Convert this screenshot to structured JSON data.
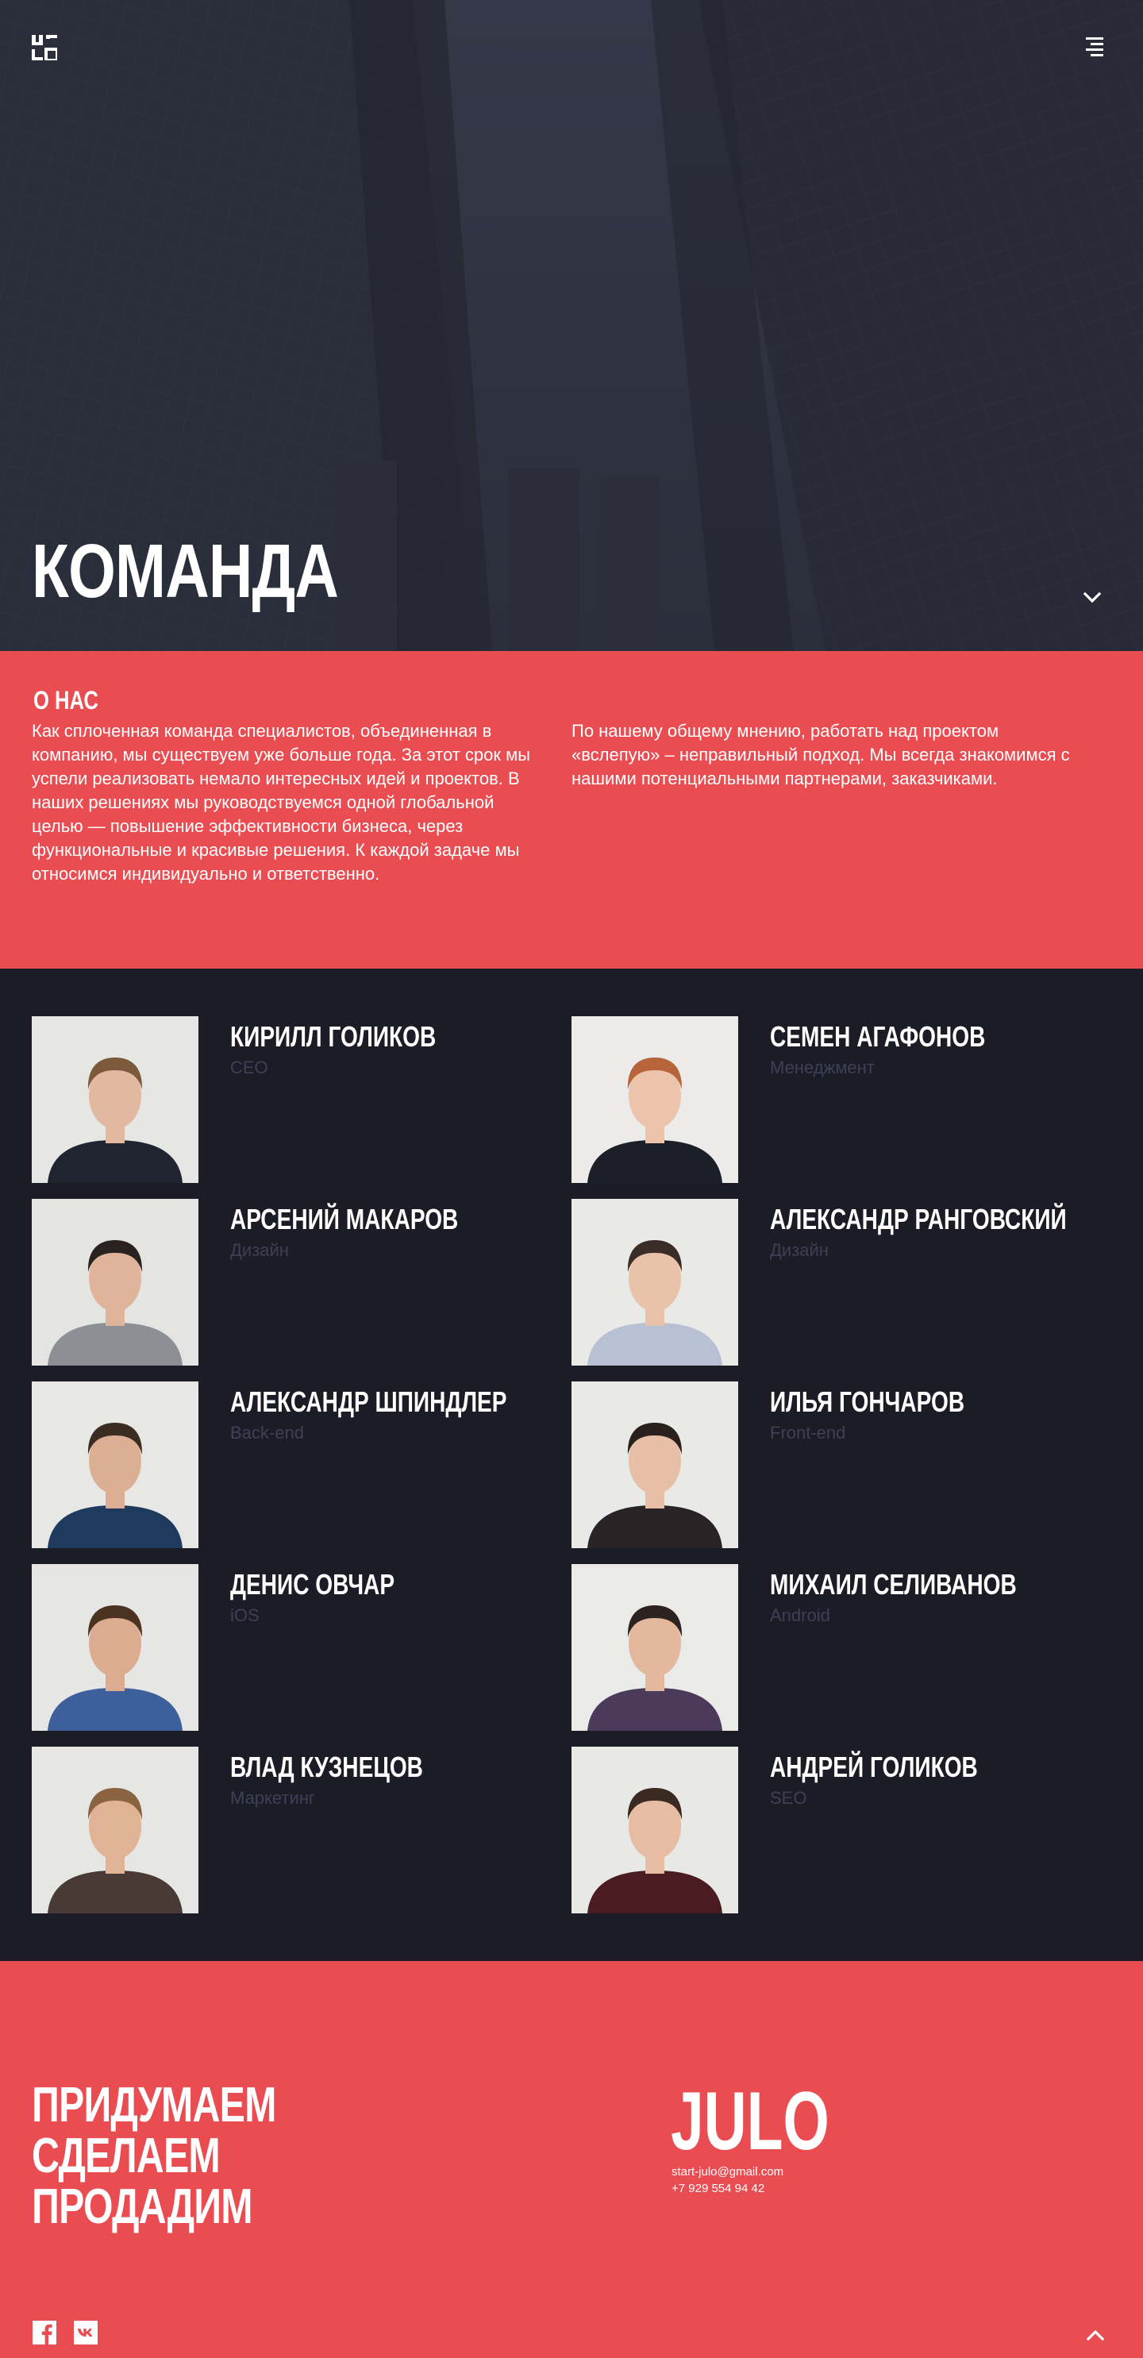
{
  "header": {
    "logo_icon": "julo-logo-icon",
    "menu_icon": "menu-icon"
  },
  "hero": {
    "title": "КОМАНДА",
    "scroll_icon": "chevron-down-icon"
  },
  "about": {
    "heading": "О НАС",
    "paragraph_1": "Как сплоченная команда специалистов, объединенная в компанию, мы существуем уже больше года. За этот срок мы успели реализовать немало интересных идей и проектов.  В наших решениях мы руководствуемся одной глобальной целью — повышение эффективности бизнеса, через функциональные и красивые решения. К каждой задаче мы относимся индивидуально и ответственно.",
    "paragraph_2": "По нашему общему  мнению, работать над проектом «вслепую» – неправильный подход. Мы всегда знакомимся с нашими потенциальными партнерами, заказчиками."
  },
  "team": {
    "members": [
      {
        "name": "КИРИЛЛ ГОЛИКОВ",
        "role": "CEO"
      },
      {
        "name": "СЕМЕН АГАФОНОВ",
        "role": "Менеджмент"
      },
      {
        "name": "АРСЕНИЙ МАКАРОВ",
        "role": "Дизайн"
      },
      {
        "name": "АЛЕКСАНДР РАНГОВСКИЙ",
        "role": "Дизайн"
      },
      {
        "name": "АЛЕКСАНДР ШПИНДЛЕР",
        "role": "Back-end"
      },
      {
        "name": "ИЛЬЯ ГОНЧАРОВ",
        "role": "Front-end"
      },
      {
        "name": "ДЕНИС ОВЧАР",
        "role": "iOS"
      },
      {
        "name": "МИХАИЛ СЕЛИВАНОВ",
        "role": "Android"
      },
      {
        "name": "ВЛАД КУЗНЕЦОВ",
        "role": "Маркетинг"
      },
      {
        "name": "АНДРЕЙ ГОЛИКОВ",
        "role": "SEO"
      }
    ]
  },
  "footer": {
    "slogan_line_1": "ПРИДУМАЕМ",
    "slogan_line_2": "СДЕЛАЕМ",
    "slogan_line_3": "ПРОДАДИМ",
    "brand": "JULO",
    "email": "start-julo@gmail.com",
    "phone": "+7 929 554 94 42",
    "social_icons": [
      "facebook-icon",
      "vk-icon"
    ],
    "to_top_icon": "chevron-up-icon"
  },
  "colors": {
    "accent": "#e94d52",
    "dark_bg": "#1b1c26",
    "hero_bg": "#2e3140",
    "role_text": "#3c4156"
  }
}
